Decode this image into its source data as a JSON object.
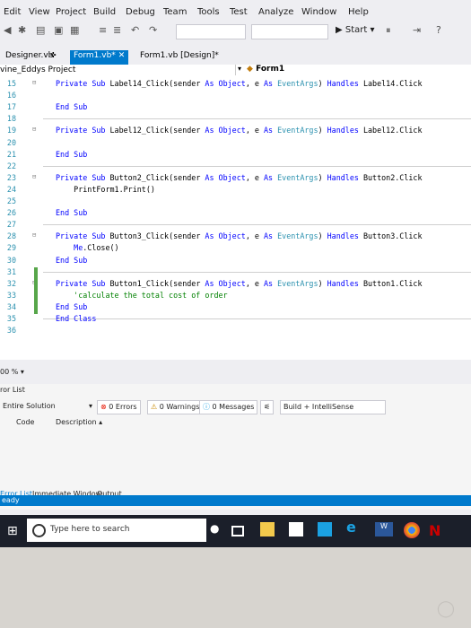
{
  "menu": [
    "Edit",
    "View",
    "Project",
    "Build",
    "Debug",
    "Team",
    "Tools",
    "Test",
    "Analyze",
    "Window",
    "Help"
  ],
  "toolbar": {
    "start_label": "Start"
  },
  "tabs": {
    "designer": "Designer.vb",
    "form1_vb": "Form1.vb*",
    "form1_design": "Form1.vb [Design]*"
  },
  "nav": {
    "project": "vine_Eddys Project",
    "class": "Form1"
  },
  "code_lines": [
    {
      "n": "15",
      "parts": [
        [
          "kw",
          "Private Sub "
        ],
        [
          "",
          "Label14_Click(sender "
        ],
        [
          "kw",
          "As "
        ],
        [
          "kw",
          "Object"
        ],
        [
          "",
          ", e "
        ],
        [
          "kw",
          "As "
        ],
        [
          "ty",
          "EventArgs"
        ],
        [
          "",
          ") "
        ],
        [
          "kw",
          "Handles "
        ],
        [
          "",
          "Label14.Click"
        ]
      ]
    },
    {
      "n": "16",
      "parts": []
    },
    {
      "n": "17",
      "parts": [
        [
          "kw",
          "End Sub"
        ]
      ]
    },
    {
      "n": "18",
      "parts": []
    },
    {
      "n": "19",
      "parts": [
        [
          "kw",
          "Private Sub "
        ],
        [
          "",
          "Label12_Click(sender "
        ],
        [
          "kw",
          "As "
        ],
        [
          "kw",
          "Object"
        ],
        [
          "",
          ", e "
        ],
        [
          "kw",
          "As "
        ],
        [
          "ty",
          "EventArgs"
        ],
        [
          "",
          ") "
        ],
        [
          "kw",
          "Handles "
        ],
        [
          "",
          "Label12.Click"
        ]
      ]
    },
    {
      "n": "20",
      "parts": []
    },
    {
      "n": "21",
      "parts": [
        [
          "kw",
          "End Sub"
        ]
      ]
    },
    {
      "n": "22",
      "parts": []
    },
    {
      "n": "23",
      "parts": [
        [
          "kw",
          "Private Sub "
        ],
        [
          "",
          "Button2_Click(sender "
        ],
        [
          "kw",
          "As "
        ],
        [
          "kw",
          "Object"
        ],
        [
          "",
          ", e "
        ],
        [
          "kw",
          "As "
        ],
        [
          "ty",
          "EventArgs"
        ],
        [
          "",
          ") "
        ],
        [
          "kw",
          "Handles "
        ],
        [
          "",
          "Button2.Click"
        ]
      ]
    },
    {
      "n": "24",
      "parts": [
        [
          "",
          "    PrintForm1.Print()"
        ]
      ]
    },
    {
      "n": "25",
      "parts": []
    },
    {
      "n": "26",
      "parts": [
        [
          "kw",
          "End Sub"
        ]
      ]
    },
    {
      "n": "27",
      "parts": []
    },
    {
      "n": "28",
      "parts": [
        [
          "kw",
          "Private Sub "
        ],
        [
          "",
          "Button3_Click(sender "
        ],
        [
          "kw",
          "As "
        ],
        [
          "kw",
          "Object"
        ],
        [
          "",
          ", e "
        ],
        [
          "kw",
          "As "
        ],
        [
          "ty",
          "EventArgs"
        ],
        [
          "",
          ") "
        ],
        [
          "kw",
          "Handles "
        ],
        [
          "",
          "Button3.Click"
        ]
      ]
    },
    {
      "n": "29",
      "parts": [
        [
          "kw",
          "    Me"
        ],
        [
          "",
          ".Close()"
        ]
      ]
    },
    {
      "n": "30",
      "parts": [
        [
          "kw",
          "End Sub"
        ]
      ]
    },
    {
      "n": "31",
      "parts": []
    },
    {
      "n": "32",
      "parts": [
        [
          "kw",
          "Private Sub "
        ],
        [
          "",
          "Button1_Click(sender "
        ],
        [
          "kw",
          "As "
        ],
        [
          "kw",
          "Object"
        ],
        [
          "",
          ", e "
        ],
        [
          "kw",
          "As "
        ],
        [
          "ty",
          "EventArgs"
        ],
        [
          "",
          ") "
        ],
        [
          "kw",
          "Handles "
        ],
        [
          "",
          "Button1.Click"
        ]
      ]
    },
    {
      "n": "33",
      "parts": [
        [
          "cm",
          "    'calculate the total cost of order"
        ]
      ]
    },
    {
      "n": "34",
      "parts": [
        [
          "kw",
          "End Sub"
        ]
      ]
    },
    {
      "n": "35",
      "parts": [
        [
          "kw",
          "End Class"
        ]
      ]
    },
    {
      "n": "36",
      "parts": []
    }
  ],
  "zoom": "00 %",
  "error_list": {
    "title": "ror List",
    "scope": "Entire Solution",
    "errors": "0 Errors",
    "warnings": "0 Warnings",
    "messages": "0 Messages",
    "build": "Build + IntelliSense",
    "col_code": "Code",
    "col_desc": "Description"
  },
  "bottom_tabs": [
    "Error List",
    "Immediate Window",
    "Output"
  ],
  "status": "eady",
  "taskbar": {
    "search_placeholder": "Type here to search"
  },
  "colors": {
    "accent": "#007acc",
    "keyword": "#0000ff",
    "type": "#2b91af",
    "comment": "#008000"
  }
}
